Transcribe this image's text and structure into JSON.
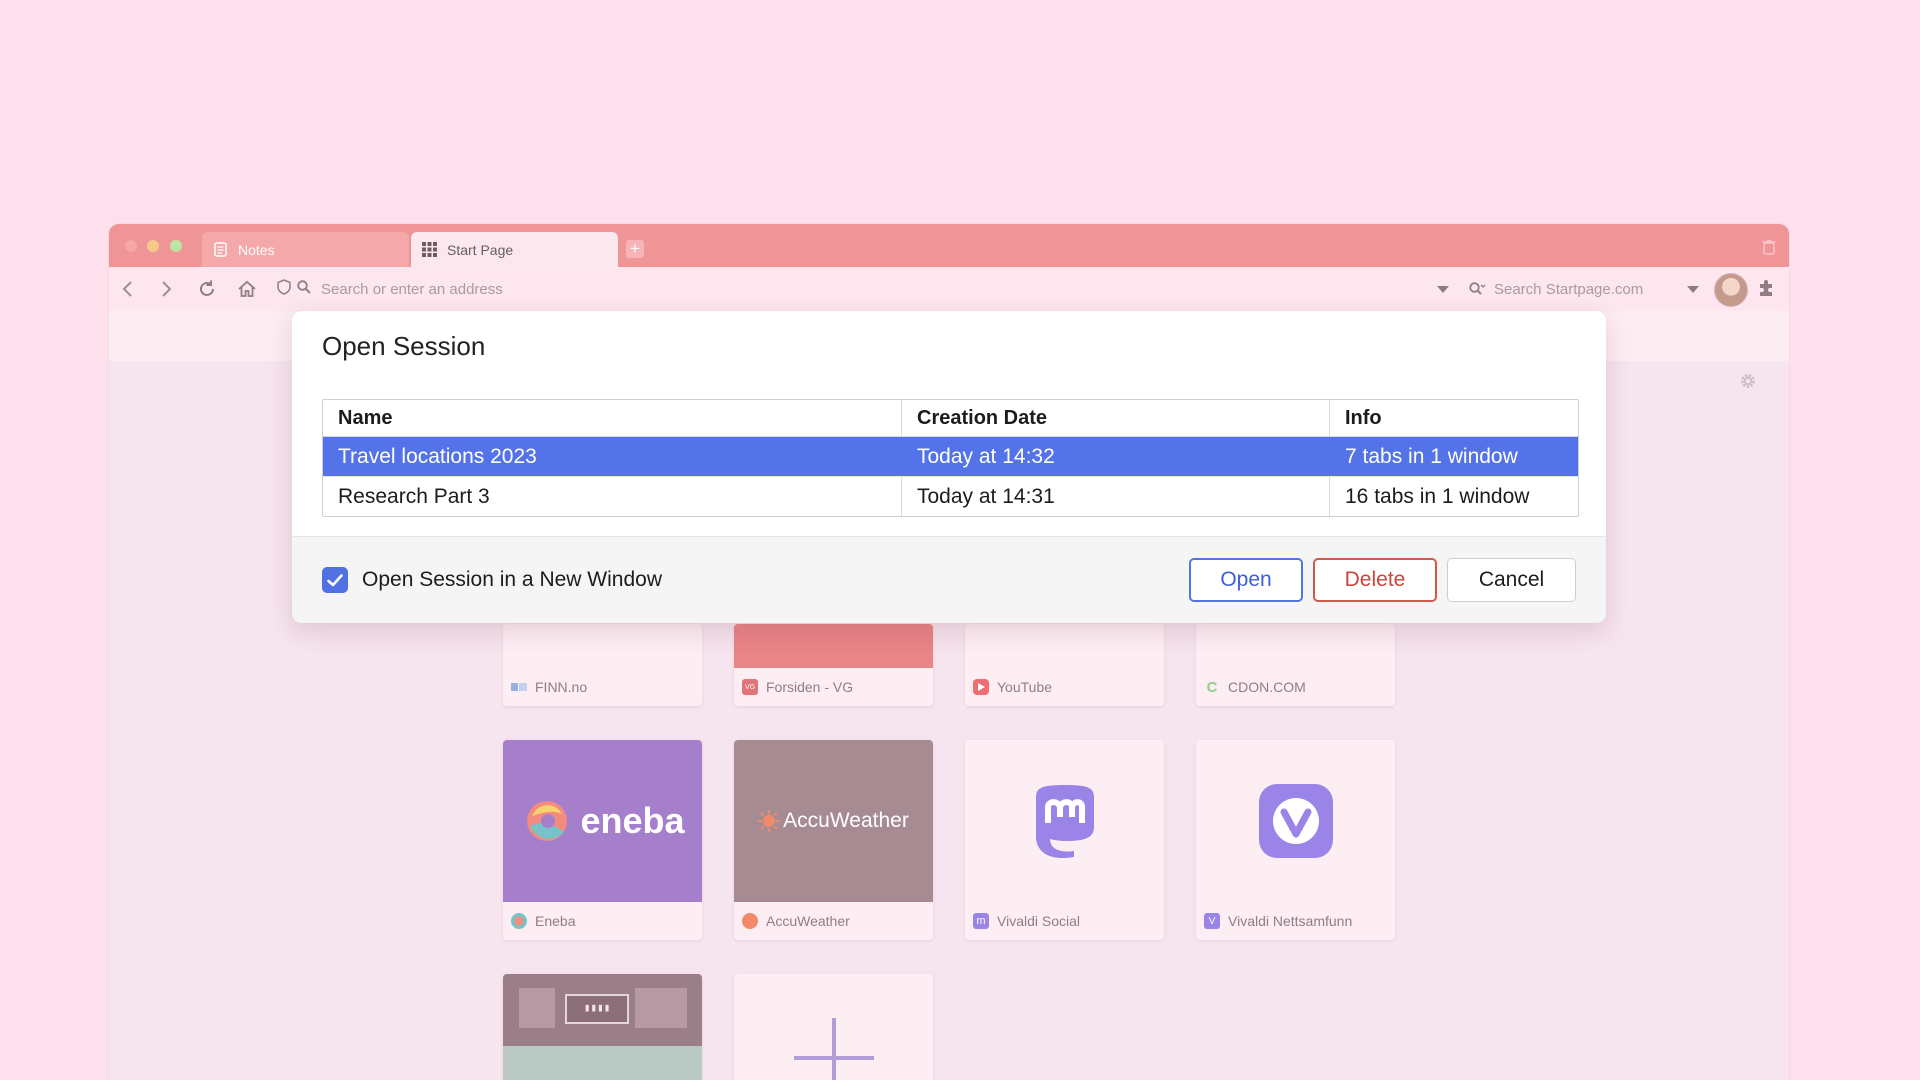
{
  "browser": {
    "tabs": [
      {
        "label": "Notes",
        "icon": "notes-icon"
      },
      {
        "label": "Start Page",
        "icon": "grid-icon"
      }
    ],
    "address_placeholder": "Search or enter an address",
    "search_placeholder": "Search Startpage.com"
  },
  "speed_dials": [
    {
      "label": "FINN.no",
      "icon": "finn-icon"
    },
    {
      "label": "Forsiden - VG",
      "icon": "vg-icon"
    },
    {
      "label": "YouTube",
      "icon": "youtube-icon"
    },
    {
      "label": "CDON.COM",
      "icon": "cdon-icon"
    },
    {
      "label": "Eneba",
      "icon": "eneba-icon",
      "thumb_text": "eneba"
    },
    {
      "label": "AccuWeather",
      "icon": "accuweather-icon",
      "thumb_text": "AccuWeather"
    },
    {
      "label": "Vivaldi Social",
      "icon": "mastodon-icon"
    },
    {
      "label": "Vivaldi Nettsamfunn",
      "icon": "vivaldi-icon"
    }
  ],
  "dialog": {
    "title": "Open Session",
    "columns": [
      "Name",
      "Creation Date",
      "Info"
    ],
    "rows": [
      {
        "name": "Travel locations 2023",
        "date": "Today at 14:32",
        "info": "7 tabs in 1 window",
        "selected": true
      },
      {
        "name": "Research Part 3",
        "date": "Today at 14:31",
        "info": "16 tabs in 1 window",
        "selected": false
      }
    ],
    "new_window_label": "Open Session in a New Window",
    "new_window_checked": true,
    "buttons": {
      "open": "Open",
      "delete": "Delete",
      "cancel": "Cancel"
    }
  },
  "colors": {
    "background": "#fde0ec",
    "titlebar": "#ef9598",
    "selection": "#5473e8",
    "delete": "#c8463b"
  }
}
